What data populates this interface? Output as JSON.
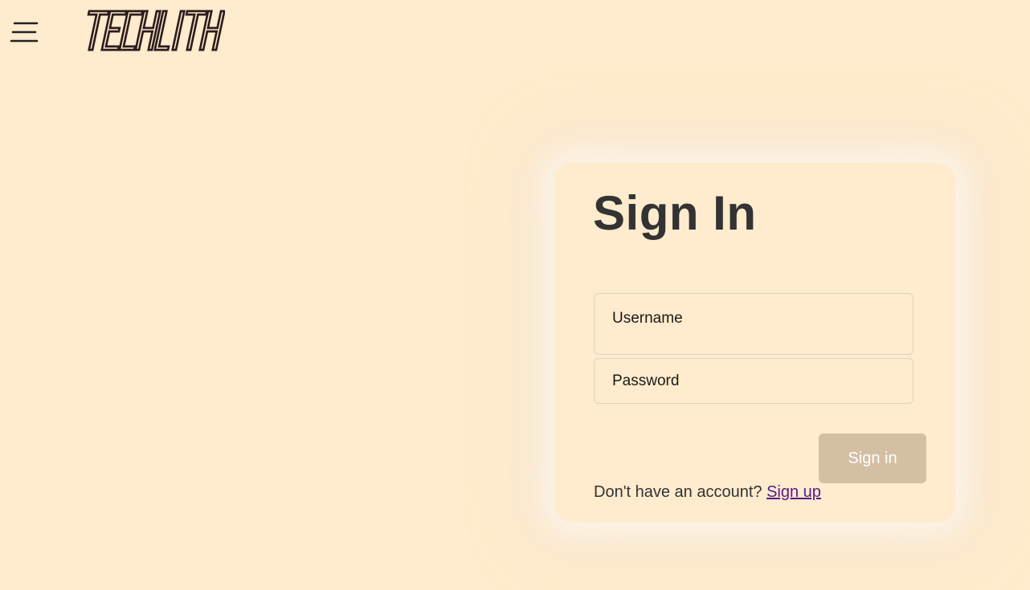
{
  "header": {
    "menu_icon": "hamburger-menu-icon",
    "logo_text": "TECHLITH"
  },
  "signin_card": {
    "title": "Sign In",
    "username_placeholder": "Username",
    "password_placeholder": "Password",
    "submit_label": "Sign in",
    "signup_prompt": "Don't have an account?",
    "signup_link": "Sign up"
  },
  "colors": {
    "background": "#FFEBCD",
    "button": "#D5BFA3",
    "title_text": "#333333",
    "link": "#551A8B"
  }
}
